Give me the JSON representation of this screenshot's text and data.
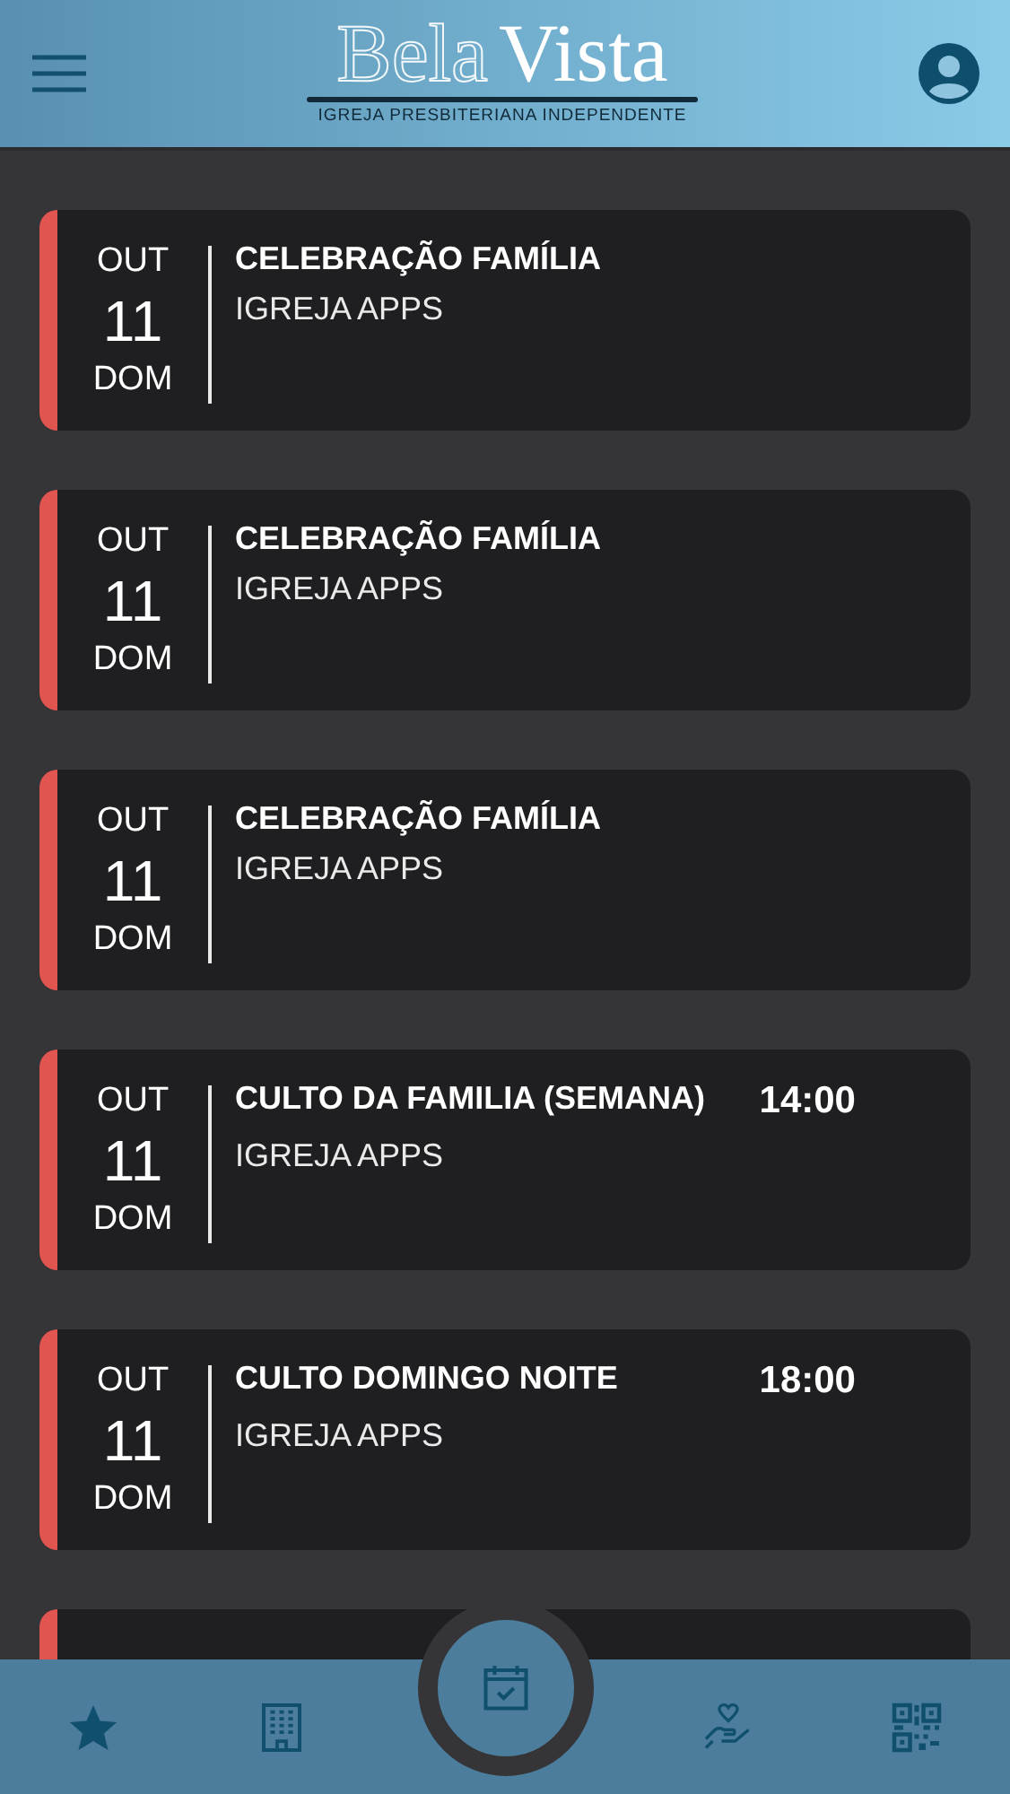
{
  "header": {
    "logo": {
      "word_1": "Bela",
      "word_2": "Vista",
      "subtitle": "IGREJA PRESBITERIANA INDEPENDENTE"
    }
  },
  "events": [
    {
      "month": "OUT",
      "day": "11",
      "weekday": "DOM",
      "title": "CELEBRAÇÃO FAMÍLIA",
      "organizer": "IGREJA APPS"
    },
    {
      "month": "OUT",
      "day": "11",
      "weekday": "DOM",
      "title": "CELEBRAÇÃO FAMÍLIA",
      "organizer": "IGREJA APPS"
    },
    {
      "month": "OUT",
      "day": "11",
      "weekday": "DOM",
      "title": "CELEBRAÇÃO FAMÍLIA",
      "organizer": "IGREJA APPS"
    },
    {
      "month": "OUT",
      "day": "11",
      "weekday": "DOM",
      "title": "CULTO DA FAMILIA (SEMANA)",
      "organizer": "IGREJA APPS",
      "time": "14:00"
    },
    {
      "month": "OUT",
      "day": "11",
      "weekday": "DOM",
      "title": "CULTO DOMINGO NOITE",
      "organizer": "IGREJA APPS",
      "time": "18:00"
    },
    {
      "partial": true
    }
  ],
  "nav": [
    {
      "kind": "star",
      "selected": false
    },
    {
      "kind": "building",
      "selected": false
    },
    {
      "kind": "calendar",
      "selected": true
    },
    {
      "kind": "donate",
      "selected": false
    },
    {
      "kind": "qr",
      "selected": false
    }
  ]
}
